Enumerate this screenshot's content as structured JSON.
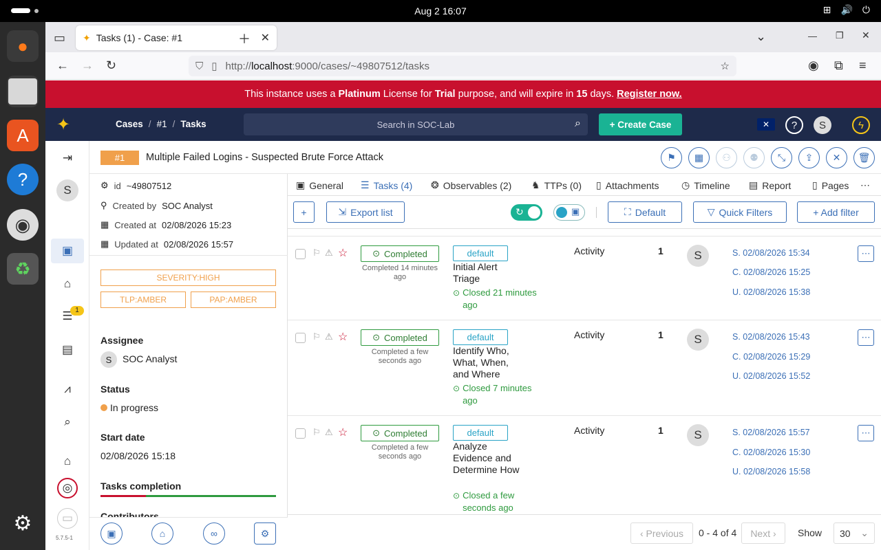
{
  "os": {
    "clock": "Aug 2  16:07"
  },
  "browser": {
    "tab_title": "Tasks (1) - Case: #1",
    "url_prefix": "http://",
    "url_host": "localhost",
    "url_rest": ":9000/cases/~49807512/tasks"
  },
  "banner": {
    "t1": "This instance uses a",
    "license": "Platinum",
    "t2": "License for",
    "trial": "Trial",
    "t3": "purpose, and will expire in",
    "days": "15",
    "t4": "days.",
    "register": "Register now."
  },
  "header": {
    "crumb_cases": "Cases",
    "crumb_case": "#1",
    "crumb_tasks": "Tasks",
    "search_placeholder": "Search in SOC-Lab",
    "create_case": "+ Create Case",
    "user_initial": "S"
  },
  "case": {
    "number": "#1",
    "title": "Multiple Failed Logins - Suspected Brute Force Attack",
    "id_label": "id",
    "id_value": "~49807512",
    "created_by_label": "Created by",
    "created_by": "SOC Analyst",
    "created_at_label": "Created at",
    "created_at": "02/08/2026 15:23",
    "updated_at_label": "Updated at",
    "updated_at": "02/08/2026 15:57",
    "severity": "SEVERITY:HIGH",
    "tlp": "TLP:AMBER",
    "pap": "PAP:AMBER",
    "assignee_label": "Assignee",
    "assignee_initial": "S",
    "assignee": "SOC Analyst",
    "status_label": "Status",
    "status": "In progress",
    "start_label": "Start date",
    "start": "02/08/2026 15:18",
    "completion_label": "Tasks completion",
    "contrib_label": "Contributors",
    "tasks_badge": "1",
    "version": "5.7.5-1"
  },
  "tabs": [
    {
      "label": "General"
    },
    {
      "label": "Tasks (4)"
    },
    {
      "label": "Observables (2)"
    },
    {
      "label": "TTPs (0)"
    },
    {
      "label": "Attachments"
    },
    {
      "label": "Timeline"
    },
    {
      "label": "Report"
    },
    {
      "label": "Pages"
    }
  ],
  "toolbar": {
    "add": "+",
    "export": "Export list",
    "default": "Default",
    "quick": "Quick Filters",
    "addfilter": "+ Add filter"
  },
  "tasks": [
    {
      "status": "Completed",
      "status_sub": "Completed 14 minutes ago",
      "group": "default",
      "name": "Initial Alert Triage",
      "closed": "Closed 21 minutes ago",
      "type": "Activity",
      "count": "1",
      "assignee": "S",
      "s": "S. 02/08/2026 15:34",
      "c": "C. 02/08/2026 15:25",
      "u": "U. 02/08/2026 15:38"
    },
    {
      "status": "Completed",
      "status_sub": "Completed a few seconds ago",
      "group": "default",
      "name": "Identify Who, What, When, and Where",
      "closed": "Closed 7 minutes ago",
      "type": "Activity",
      "count": "1",
      "assignee": "S",
      "s": "S. 02/08/2026 15:43",
      "c": "C. 02/08/2026 15:29",
      "u": "U. 02/08/2026 15:52"
    },
    {
      "status": "Completed",
      "status_sub": "Completed a few seconds ago",
      "group": "default",
      "name": "Analyze Evidence and Determine How",
      "closed": "Closed a few seconds ago",
      "type": "Activity",
      "count": "1",
      "assignee": "S",
      "s": "S. 02/08/2026 15:57",
      "c": "C. 02/08/2026 15:30",
      "u": "U. 02/08/2026 15:58"
    }
  ],
  "pager": {
    "prev": "Previous",
    "range": "0 - 4 of 4",
    "next": "Next",
    "show": "Show",
    "size": "30"
  },
  "colors": {
    "brand_red": "#c8102e",
    "navy": "#1e2a4a",
    "accent": "#3b6fb6",
    "success": "#2e9a3e",
    "amber": "#f0a04b"
  }
}
